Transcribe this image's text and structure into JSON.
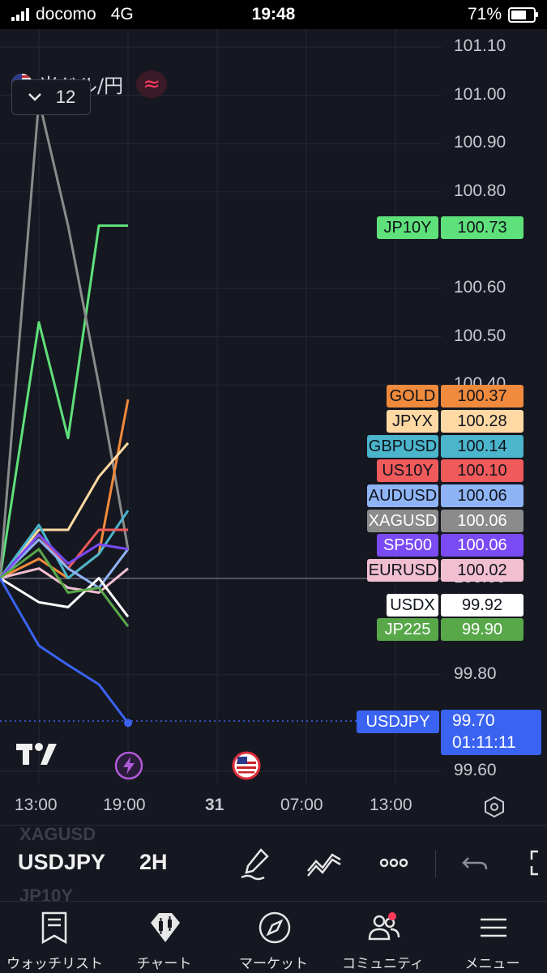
{
  "status_bar": {
    "carrier": "docomo",
    "network": "4G",
    "time": "19:48",
    "battery": "71%",
    "battery_level": 0.71
  },
  "header": {
    "symbol_name": "米ドル/円",
    "interval_label": "12"
  },
  "price_axis": [
    "101.10",
    "101.00",
    "100.90",
    "100.80",
    "100.60",
    "100.50",
    "100.40",
    "100.00",
    "99.80",
    "99.60"
  ],
  "time_axis": [
    "13:00",
    "19:00",
    "31",
    "07:00",
    "13:00"
  ],
  "chart_data": {
    "type": "line",
    "x": [
      "11:00",
      "13:00",
      "15:00",
      "17:00",
      "19:00"
    ],
    "ylim": [
      99.6,
      101.1
    ],
    "series": [
      {
        "name": "JP10Y",
        "color": "#5ee07a",
        "values": [
          100.0,
          100.53,
          100.29,
          100.73,
          100.73
        ]
      },
      {
        "name": "XAGUSD",
        "color": "#8b8b8b",
        "values": [
          100.0,
          100.99,
          100.73,
          100.4,
          100.06
        ]
      },
      {
        "name": "GOLD",
        "color": "#f08a3c",
        "values": [
          100.0,
          100.04,
          100.0,
          100.05,
          100.37
        ]
      },
      {
        "name": "JPYX",
        "color": "#ffd9a3",
        "values": [
          100.0,
          100.1,
          100.1,
          100.21,
          100.28
        ]
      },
      {
        "name": "GBPUSD",
        "color": "#4bb5cc",
        "values": [
          100.0,
          100.11,
          100.0,
          100.05,
          100.14
        ]
      },
      {
        "name": "US10Y",
        "color": "#f05a5a",
        "values": [
          100.0,
          100.09,
          100.02,
          100.1,
          100.1
        ]
      },
      {
        "name": "AUDUSD",
        "color": "#8fb4f5",
        "values": [
          100.0,
          100.08,
          100.02,
          99.98,
          100.06
        ]
      },
      {
        "name": "SP500",
        "color": "#7a4af5",
        "values": [
          100.0,
          100.09,
          100.03,
          100.07,
          100.06
        ]
      },
      {
        "name": "EURUSD",
        "color": "#f2bfd0",
        "values": [
          100.0,
          100.02,
          99.98,
          99.97,
          100.02
        ]
      },
      {
        "name": "USDX",
        "color": "#ffffff",
        "values": [
          100.0,
          99.95,
          99.94,
          100.0,
          99.92
        ]
      },
      {
        "name": "JP225",
        "color": "#58a84a",
        "values": [
          100.0,
          100.06,
          99.97,
          99.98,
          99.9
        ]
      },
      {
        "name": "USDJPY",
        "color": "#3a63f2",
        "values": [
          100.0,
          99.86,
          99.82,
          99.78,
          99.7
        ]
      }
    ]
  },
  "price_tags": [
    {
      "name": "JP10Y",
      "value": "100.73",
      "bg": "#5ee07a",
      "fg": "#10141c"
    },
    {
      "name": "GOLD",
      "value": "100.37",
      "bg": "#f08a3c",
      "fg": "#10141c"
    },
    {
      "name": "JPYX",
      "value": "100.28",
      "bg": "#ffd9a3",
      "fg": "#10141c"
    },
    {
      "name": "GBPUSD",
      "value": "100.14",
      "bg": "#4bb5cc",
      "fg": "#10141c"
    },
    {
      "name": "US10Y",
      "value": "100.10",
      "bg": "#f05a5a",
      "fg": "#10141c"
    },
    {
      "name": "AUDUSD",
      "value": "100.06",
      "bg": "#8fb4f5",
      "fg": "#10141c"
    },
    {
      "name": "XAGUSD",
      "value": "100.06",
      "bg": "#8b8b8b",
      "fg": "#ffffff"
    },
    {
      "name": "SP500",
      "value": "100.06",
      "bg": "#7a4af5",
      "fg": "#ffffff"
    },
    {
      "name": "EURUSD",
      "value": "100.02",
      "bg": "#f2bfd0",
      "fg": "#10141c"
    },
    {
      "name": "USDX",
      "value": "99.92",
      "bg": "#ffffff",
      "fg": "#10141c"
    },
    {
      "name": "JP225",
      "value": "99.90",
      "bg": "#58a84a",
      "fg": "#ffffff"
    }
  ],
  "usdjpy_tag": {
    "name": "USDJPY",
    "value": "99.70",
    "countdown": "01:11:11",
    "bg": "#3a63f2",
    "fg": "#ffffff"
  },
  "toolbar": {
    "symbol": "USDJPY",
    "interval": "2H",
    "ghost_top": "XAGUSD",
    "ghost_bottom": "JP10Y"
  },
  "bottom_nav": [
    {
      "label": "ウォッチリスト",
      "icon": "watchlist-icon"
    },
    {
      "label": "チャート",
      "icon": "chart-icon"
    },
    {
      "label": "マーケット",
      "icon": "compass-icon"
    },
    {
      "label": "コミュニティ",
      "icon": "community-icon"
    },
    {
      "label": "メニュー",
      "icon": "menu-icon"
    }
  ]
}
